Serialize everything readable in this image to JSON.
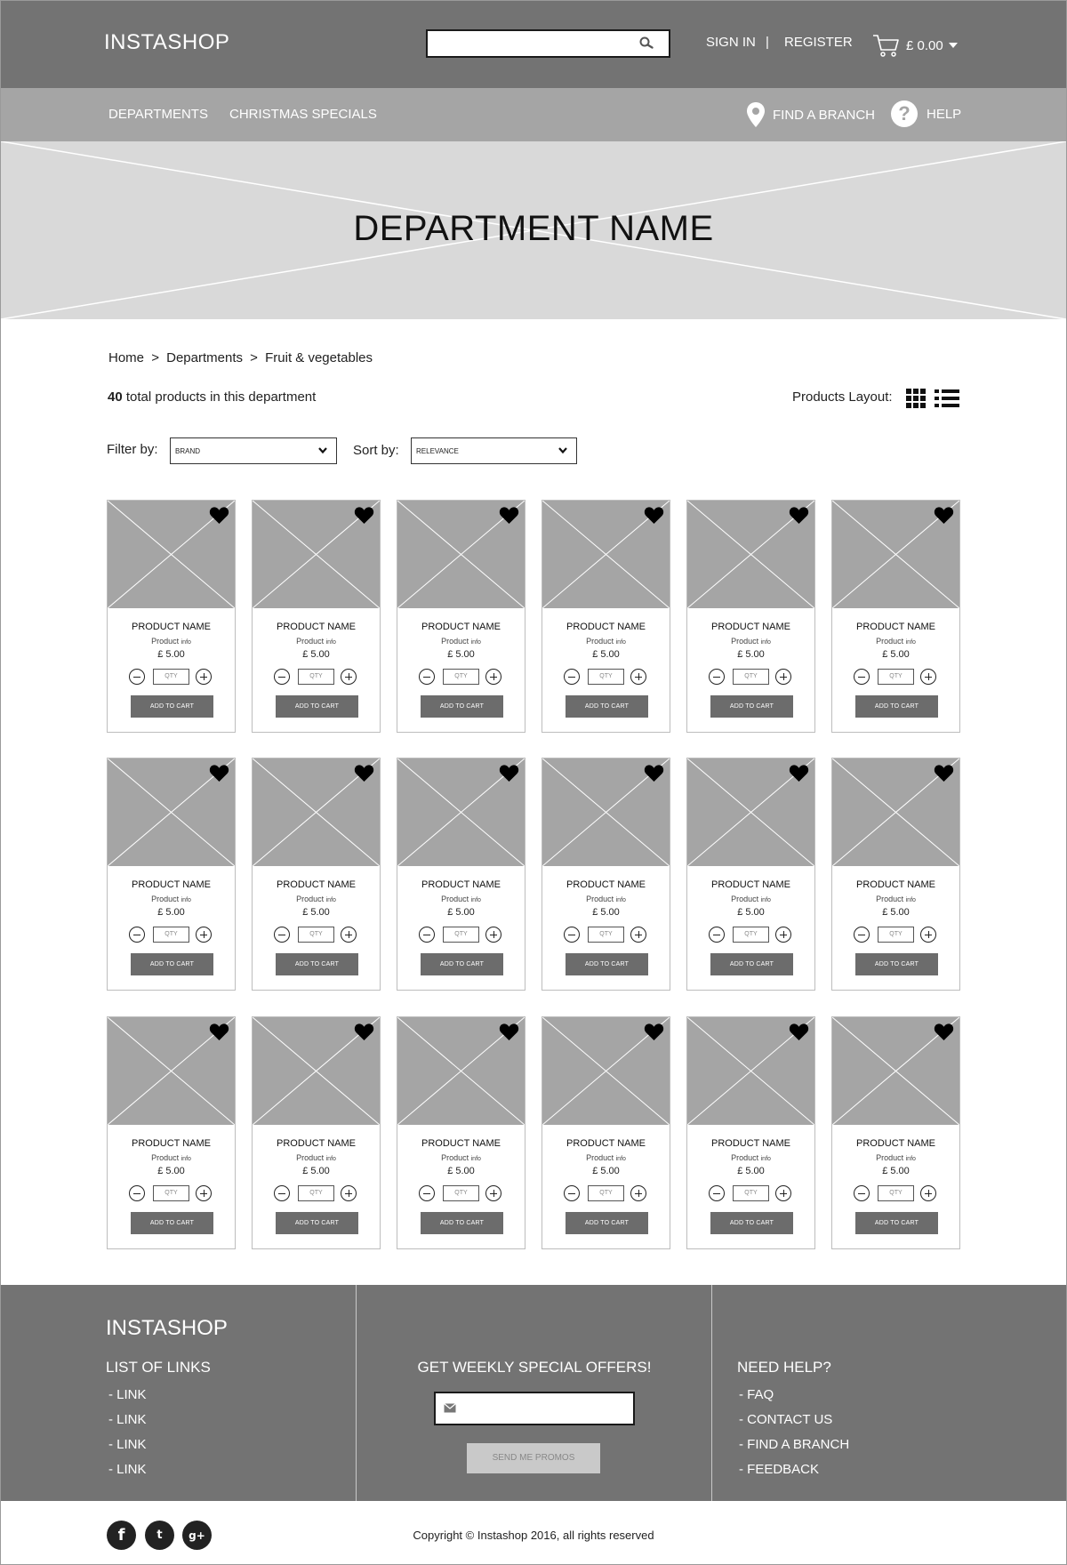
{
  "header": {
    "logo": "INSTASHOP",
    "search": {
      "value": "",
      "placeholder": ""
    },
    "sign_in": "SIGN IN",
    "separator": "|",
    "register": "REGISTER",
    "cart_total": "£ 0.00"
  },
  "nav": {
    "departments": "DEPARTMENTS",
    "christmas": "CHRISTMAS SPECIALS",
    "find_branch": "FIND A BRANCH",
    "help": "HELP",
    "help_glyph": "?"
  },
  "hero": {
    "title": "DEPARTMENT NAME"
  },
  "breadcrumb": [
    "Home",
    ">",
    "Departments",
    ">",
    "Fruit & vegetables"
  ],
  "summary": {
    "count": "40",
    "text": " total products in this department"
  },
  "layout": {
    "label": "Products Layout:"
  },
  "filter": {
    "label": "Filter by:",
    "value": "BRAND"
  },
  "sort": {
    "label": "Sort by:",
    "value": "RELEVANCE"
  },
  "products": [
    {
      "name": "PRODUCT NAME",
      "info_a": "Product",
      "info_b": "info",
      "price": "£ 5.00",
      "qty_placeholder": "QTY",
      "button": "ADD TO CART"
    },
    {
      "name": "PRODUCT NAME",
      "info_a": "Product",
      "info_b": "info",
      "price": "£ 5.00",
      "qty_placeholder": "QTY",
      "button": "ADD TO CART"
    },
    {
      "name": "PRODUCT NAME",
      "info_a": "Product",
      "info_b": "info",
      "price": "£ 5.00",
      "qty_placeholder": "QTY",
      "button": "ADD TO CART"
    },
    {
      "name": "PRODUCT NAME",
      "info_a": "Product",
      "info_b": "info",
      "price": "£ 5.00",
      "qty_placeholder": "QTY",
      "button": "ADD TO CART"
    },
    {
      "name": "PRODUCT NAME",
      "info_a": "Product",
      "info_b": "info",
      "price": "£ 5.00",
      "qty_placeholder": "QTY",
      "button": "ADD TO CART"
    },
    {
      "name": "PRODUCT NAME",
      "info_a": "Product",
      "info_b": "info",
      "price": "£ 5.00",
      "qty_placeholder": "QTY",
      "button": "ADD TO CART"
    },
    {
      "name": "PRODUCT NAME",
      "info_a": "Product",
      "info_b": "info",
      "price": "£ 5.00",
      "qty_placeholder": "QTY",
      "button": "ADD TO CART"
    },
    {
      "name": "PRODUCT NAME",
      "info_a": "Product",
      "info_b": "info",
      "price": "£ 5.00",
      "qty_placeholder": "QTY",
      "button": "ADD TO CART"
    },
    {
      "name": "PRODUCT NAME",
      "info_a": "Product",
      "info_b": "info",
      "price": "£ 5.00",
      "qty_placeholder": "QTY",
      "button": "ADD TO CART"
    },
    {
      "name": "PRODUCT NAME",
      "info_a": "Product",
      "info_b": "info",
      "price": "£ 5.00",
      "qty_placeholder": "QTY",
      "button": "ADD TO CART"
    },
    {
      "name": "PRODUCT NAME",
      "info_a": "Product",
      "info_b": "info",
      "price": "£ 5.00",
      "qty_placeholder": "QTY",
      "button": "ADD TO CART"
    },
    {
      "name": "PRODUCT NAME",
      "info_a": "Product",
      "info_b": "info",
      "price": "£ 5.00",
      "qty_placeholder": "QTY",
      "button": "ADD TO CART"
    },
    {
      "name": "PRODUCT NAME",
      "info_a": "Product",
      "info_b": "info",
      "price": "£ 5.00",
      "qty_placeholder": "QTY",
      "button": "ADD TO CART"
    },
    {
      "name": "PRODUCT NAME",
      "info_a": "Product",
      "info_b": "info",
      "price": "£ 5.00",
      "qty_placeholder": "QTY",
      "button": "ADD TO CART"
    },
    {
      "name": "PRODUCT NAME",
      "info_a": "Product",
      "info_b": "info",
      "price": "£ 5.00",
      "qty_placeholder": "QTY",
      "button": "ADD TO CART"
    },
    {
      "name": "PRODUCT NAME",
      "info_a": "Product",
      "info_b": "info",
      "price": "£ 5.00",
      "qty_placeholder": "QTY",
      "button": "ADD TO CART"
    },
    {
      "name": "PRODUCT NAME",
      "info_a": "Product",
      "info_b": "info",
      "price": "£ 5.00",
      "qty_placeholder": "QTY",
      "button": "ADD TO CART"
    },
    {
      "name": "PRODUCT NAME",
      "info_a": "Product",
      "info_b": "info",
      "price": "£ 5.00",
      "qty_placeholder": "QTY",
      "button": "ADD TO CART"
    }
  ],
  "footer": {
    "logo": "INSTASHOP",
    "links_title": "LIST OF LINKS",
    "links": [
      "- LINK",
      "- LINK",
      "- LINK",
      "- LINK"
    ],
    "offers_title": "GET WEEKLY SPECIAL OFFERS!",
    "email": {
      "value": "",
      "placeholder": ""
    },
    "promo_button": "SEND ME PROMOS",
    "help_title": "NEED HELP?",
    "help_links": [
      "- FAQ",
      "- CONTACT US",
      "- FIND A BRANCH",
      "- FEEDBACK"
    ]
  },
  "bottom": {
    "social": [
      {
        "icon": "facebook-icon",
        "glyph": "f"
      },
      {
        "icon": "twitter-icon",
        "glyph": "t"
      },
      {
        "icon": "google-plus-icon",
        "glyph": "g+"
      }
    ],
    "copyright": "Copyright © Instashop 2016, all rights reserved"
  },
  "colors": {
    "header_bg": "#737373",
    "nav_bg": "#a5a5a5",
    "hero_bg": "#d9d9d9",
    "placeholder_bg": "#a5a5a5",
    "button_bg": "#6c6c6c"
  }
}
